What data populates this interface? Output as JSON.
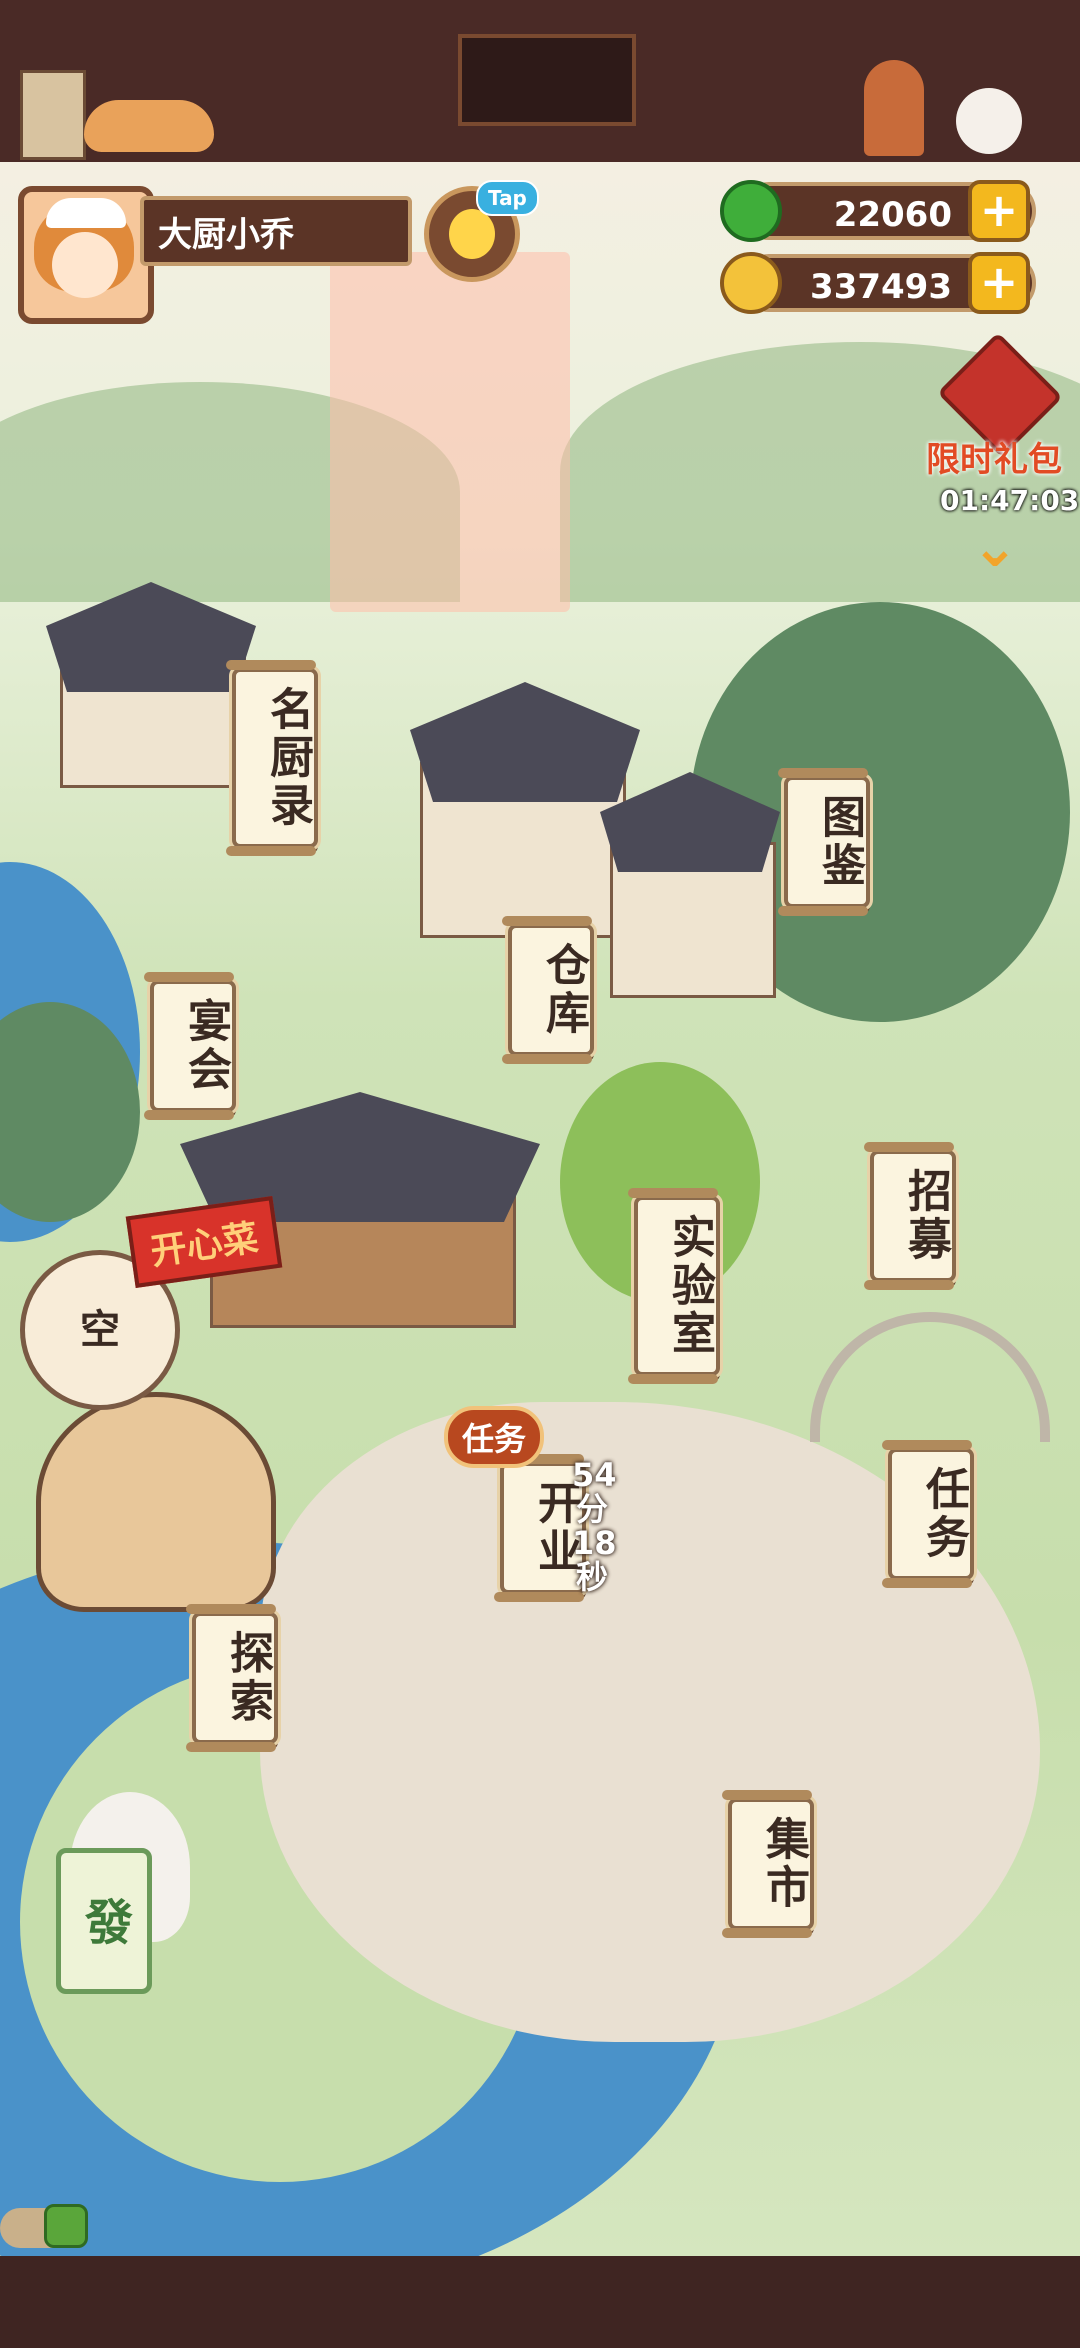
{
  "player": {
    "name": "大厨小乔"
  },
  "tap_badge": "Tap",
  "resources": {
    "jade": "22060",
    "coins": "337493",
    "plus": "+"
  },
  "gift": {
    "label": "限时礼包",
    "timer": "01:47:03"
  },
  "buildings": {
    "famous_chefs": "名厨录",
    "catalog": "图鉴",
    "banquet": "宴会",
    "warehouse": "仓库",
    "lab": "实验室",
    "recruit": "招募",
    "open_business": "开业",
    "tasks": "任务",
    "explore": "探索",
    "market": "集市"
  },
  "task_badge": "任务",
  "business_timer": {
    "minutes": "54",
    "min_unit": "分",
    "seconds": "18",
    "sec_unit": "秒"
  },
  "empty_slot": "空",
  "shop_sign": "开心菜",
  "jade_tile": "發",
  "colors": {
    "accent_gold": "#f3b81e",
    "frame_brown": "#5b3426",
    "gift_red": "#e24b24",
    "jade_green": "#3fae3a"
  }
}
